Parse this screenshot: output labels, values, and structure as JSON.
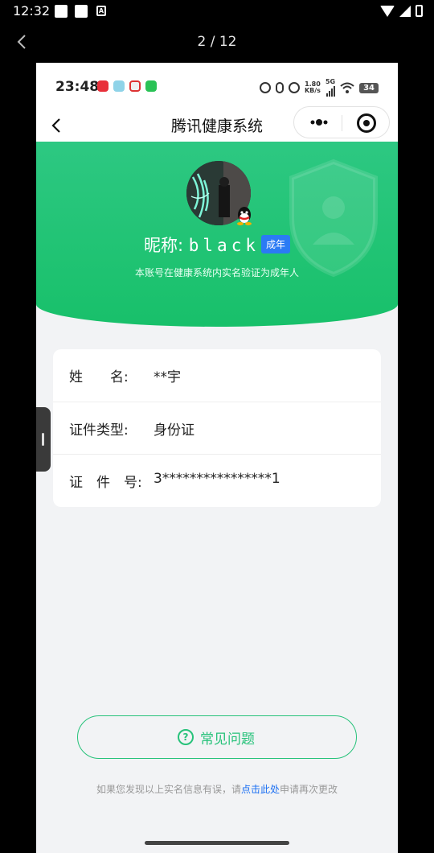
{
  "system_bar": {
    "time": "12:32"
  },
  "viewer": {
    "counter": "2 / 12"
  },
  "inner_status": {
    "time": "23:48",
    "net_speed_value": "1.80",
    "net_speed_unit": "KB/s",
    "net_type": "5G",
    "battery": "34"
  },
  "mini_nav": {
    "title": "腾讯健康系统"
  },
  "profile": {
    "nick_prefix": "昵称: ",
    "nickname": "black",
    "age_tag": "成年",
    "verify_note": "本账号在健康系统内实名验证为成年人"
  },
  "info": {
    "name_label": "姓　　名:",
    "name_value": "**宇",
    "id_type_label": "证件类型:",
    "id_type_value": "身份证",
    "id_no_label": "证　件　号:",
    "id_no_value": "3****************1"
  },
  "faq": {
    "label": "常见问题",
    "icon": "?"
  },
  "footer": {
    "prefix": "如果您发现以上实名信息有误，请",
    "link": "点击此处",
    "suffix": "申请再次更改"
  },
  "colors": {
    "brand_green": "#18c06a",
    "tag_blue": "#2b7bf4",
    "link_blue": "#1b6ff2"
  }
}
